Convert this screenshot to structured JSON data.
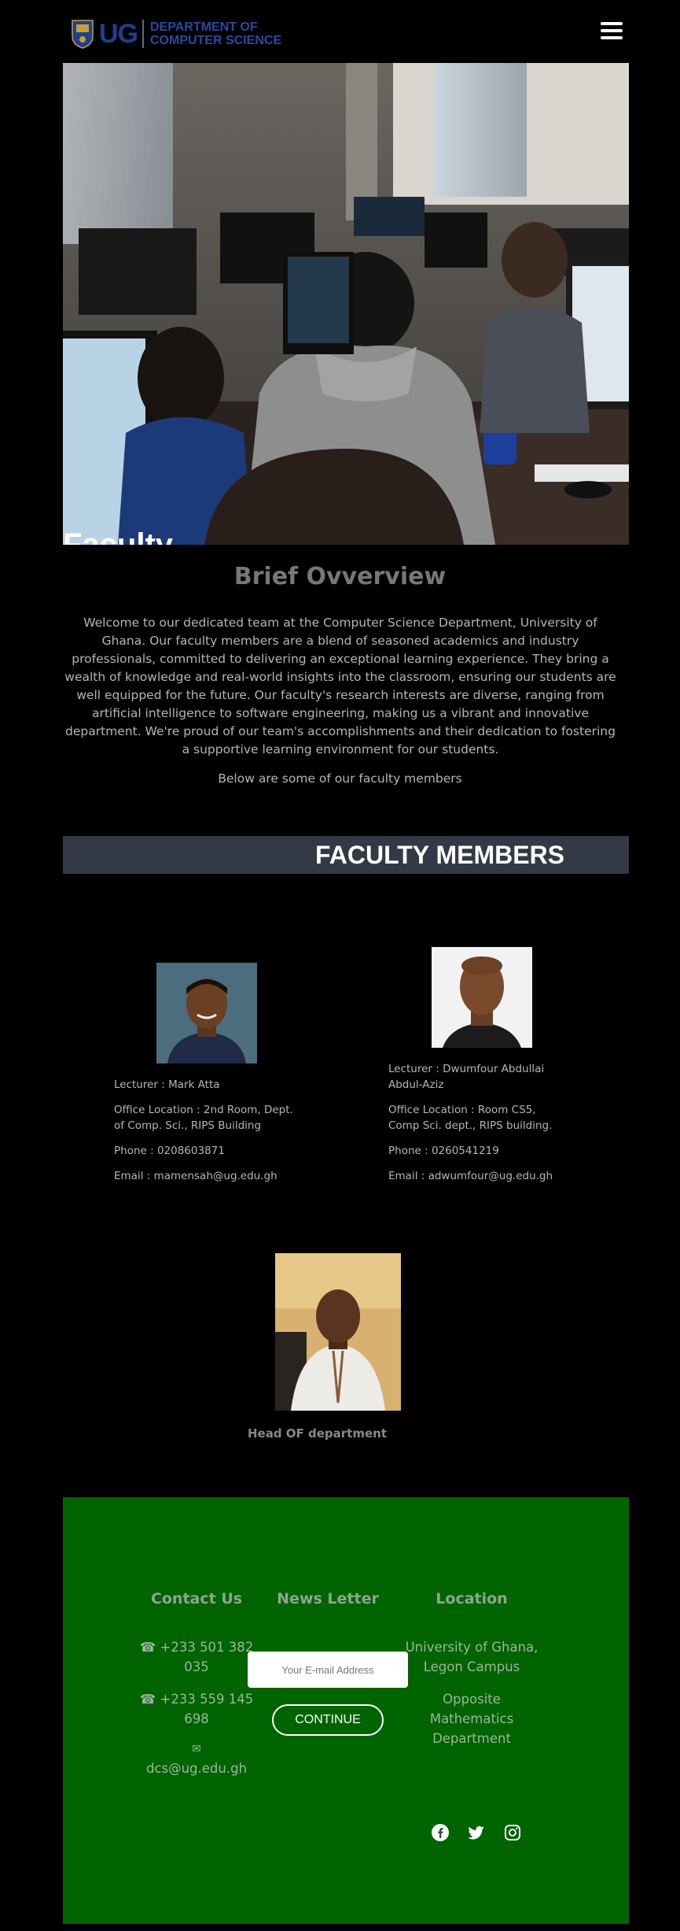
{
  "header": {
    "logo_ug": "UG",
    "dept_line1": "DEPARTMENT OF",
    "dept_line2": "COMPUTER SCIENCE",
    "menu_icon": "hamburger-menu-icon"
  },
  "hero": {
    "title": "Faculty"
  },
  "overview": {
    "title": "Brief Ovverview",
    "text": "Welcome to our dedicated team at the Computer Science Department, University of Ghana. Our faculty members are a blend of seasoned academics and industry professionals, committed to delivering an exceptional learning experience. They bring a wealth of knowledge and real-world insights into the classroom, ensuring our students are well equipped for the future. Our faculty's research interests are diverse, ranging from artificial intelligence to software engineering, making us a vibrant and innovative department. We're proud of our team's accomplishments and their dedication to fostering a supportive learning environment for our students.",
    "subtext": "Below are some of our faculty members"
  },
  "faculty": {
    "heading": "FACULTY MEMBERS",
    "members": [
      {
        "lecturer": "Lecturer : Mark Atta",
        "office": "Office Location : 2nd Room, Dept. of Comp. Sci., RIPS Building",
        "phone": "Phone : 0208603871",
        "email": "Email : mamensah@ug.edu.gh"
      },
      {
        "lecturer": "Lecturer : Dwumfour Abdullai Abdul-Aziz",
        "office": "Office Location : Room CS5, Comp Sci. dept., RIPS building.",
        "phone": "Phone : 0260541219",
        "email": "Email : adwumfour@ug.edu.gh"
      }
    ],
    "hod_label": "Head OF department"
  },
  "footer": {
    "contact": {
      "title": "Contact Us",
      "phone1": "☎ +233 501 382 035",
      "phone2": "☎ +233 559 145 698",
      "mail_glyph": "✉",
      "email": "dcs@ug.edu.gh"
    },
    "newsletter": {
      "title": "News Letter",
      "placeholder": "Your E-mail Address",
      "button": "CONTINUE"
    },
    "location": {
      "title": "Location",
      "line1": "University of Ghana, Legon Campus",
      "line2": "Opposite Mathematics Department"
    },
    "social_icons": [
      "facebook-icon",
      "twitter-icon",
      "instagram-icon"
    ]
  },
  "colors": {
    "background": "#000000",
    "footer_green": "#006400",
    "faculty_bar": "#343a45",
    "logo_blue": "#1f3f8f"
  }
}
